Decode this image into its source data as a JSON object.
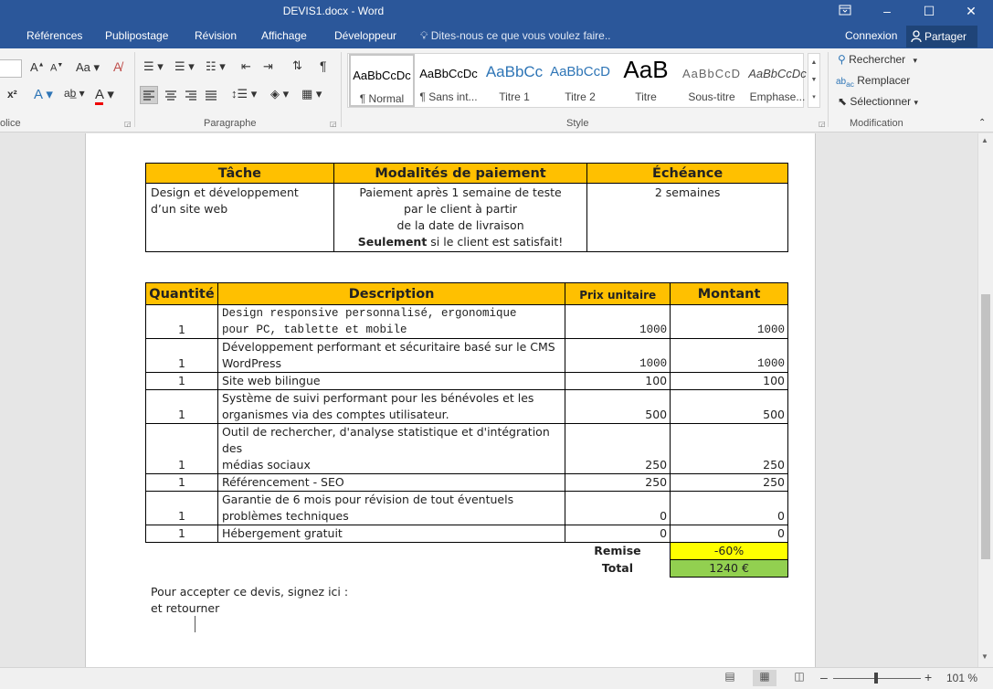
{
  "window": {
    "title": "DEVIS1.docx - Word",
    "restore_icon": "ribbon-display-icon",
    "minimize": "–",
    "maximize": "☐",
    "close": "✕"
  },
  "tabs": [
    "Références",
    "Publipostage",
    "Révision",
    "Affichage",
    "Développeur"
  ],
  "tell_me": "Dites-nous ce que vous voulez faire..",
  "account": {
    "connexion": "Connexion",
    "partager": "Partager"
  },
  "ribbon": {
    "police_label": "olice",
    "paragraphe_label": "Paragraphe",
    "style_label": "Style",
    "modification_label": "Modification",
    "styles": [
      {
        "sample": "AaBbCcDc",
        "name": "¶ Normal"
      },
      {
        "sample": "AaBbCcDc",
        "name": "¶ Sans int..."
      },
      {
        "sample": "AaBbCc",
        "name": "Titre 1"
      },
      {
        "sample": "AaBbCcD",
        "name": "Titre 2"
      },
      {
        "sample": "AaB",
        "name": "Titre"
      },
      {
        "sample": "AaBbCcD",
        "name": "Sous-titre"
      },
      {
        "sample": "AaBbCcDc",
        "name": "Emphase..."
      }
    ],
    "modification": {
      "rechercher": "Rechercher",
      "remplacer": "Remplacer",
      "selectionner": "Sélectionner"
    }
  },
  "doc": {
    "table1": {
      "headers": [
        "Tâche",
        "Modalités de paiement",
        "Échéance"
      ],
      "tache": [
        "Design et développement",
        "d’un site web"
      ],
      "modalites": [
        "Paiement après 1 semaine de teste",
        "par le client à partir",
        "de la date de livraison"
      ],
      "modalites_bold": "Seulement",
      "modalites_rest": " si le client est satisfait!",
      "echeance": "2 semaines"
    },
    "table2": {
      "headers": {
        "quantite": "Quantité",
        "description": "Description",
        "prix": "Prix unitaire",
        "montant": "Montant"
      },
      "rows": [
        {
          "q": "1",
          "d1": "Design responsive personnalisé, ergonomique",
          "d2": "pour PC, tablette et mobile",
          "p": "1000",
          "m": "1000"
        },
        {
          "q": "1",
          "d1": "Développement performant et sécuritaire basé sur le CMS",
          "d2": "WordPress",
          "p": "1000",
          "m": "1000"
        },
        {
          "q": "1",
          "d1": "Site web bilingue",
          "d2": "",
          "p": "100",
          "m": "100"
        },
        {
          "q": "1",
          "d1": "Système de suivi performant pour les bénévoles et les",
          "d2": "organismes via des comptes utilisateur.",
          "p": "500",
          "m": "500"
        },
        {
          "q": "1",
          "d1": "Outil de rechercher, d'analyse statistique et d'intégration des",
          "d2": "médias sociaux",
          "p": "250",
          "m": "250"
        },
        {
          "q": "1",
          "d1": "Référencement - SEO",
          "d2": "",
          "p": "250",
          "m": "250"
        },
        {
          "q": "1",
          "d1": "Garantie de 6 mois pour révision de tout éventuels",
          "d2": "problèmes techniques",
          "p": "0",
          "m": "0"
        },
        {
          "q": "1",
          "d1": "Hébergement gratuit",
          "d2": "",
          "p": "0",
          "m": "0"
        }
      ],
      "remise_label": "Remise",
      "remise_value": "-60%",
      "total_label": "Total",
      "total_value": "1240 €"
    },
    "footer_line1": "Pour accepter ce devis, signez ici :",
    "footer_line2": "et retourner"
  },
  "status": {
    "zoom": "101 %",
    "minus": "–",
    "plus": "+"
  },
  "colors": {
    "word_blue": "#2b579a",
    "header_orange": "#ffc000",
    "remise_yellow": "#ffff00",
    "total_green": "#92d050"
  }
}
